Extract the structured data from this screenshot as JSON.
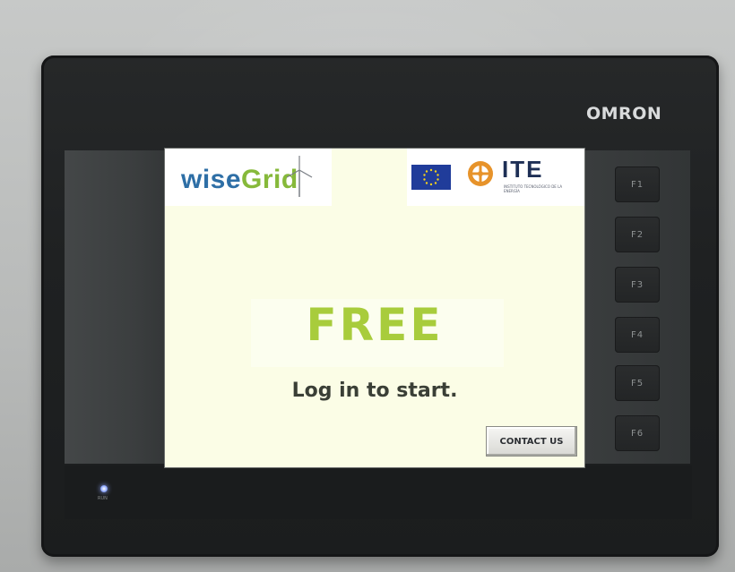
{
  "device": {
    "brand": "OMRON",
    "function_keys": [
      "F1",
      "F2",
      "F3",
      "F4",
      "F5",
      "F6"
    ],
    "led_label": "RUN"
  },
  "screen": {
    "logo_left": {
      "text_part1": "wise",
      "text_part2": "Grid"
    },
    "logo_right": {
      "org": "ITE",
      "tagline": "INSTITUTO TECNOLÓGICO DE LA ENERGÍA"
    },
    "status": "FREE",
    "prompt": "Log in to start.",
    "contact_button": "CONTACT US"
  },
  "colors": {
    "screen_bg": "#fbfde6",
    "status_green": "#a8cc3c",
    "logo_blue": "#2e6fa6",
    "logo_green": "#86b93a",
    "eu_blue": "#203c9a",
    "ite_orange": "#e7932a",
    "bezel": "#1f2122"
  },
  "icons": [
    "wind-turbine-icon",
    "eu-flag-icon",
    "ite-emblem-icon",
    "status-led-icon"
  ]
}
